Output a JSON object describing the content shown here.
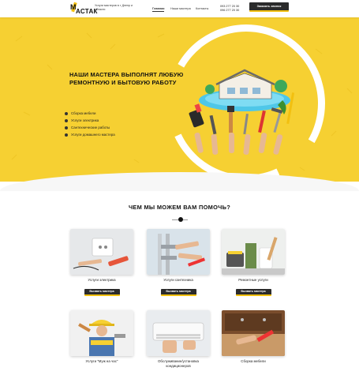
{
  "header": {
    "logo_text": "АСТАК",
    "logo_letter": "М",
    "tagline": "Услуги мастеров в г. Днепр и области",
    "nav": [
      "Главная",
      "Наши мастера",
      "Контакты"
    ],
    "phones": [
      "093 277 20 30",
      "096 277 20 30"
    ],
    "cta_label": "Заказать звонок"
  },
  "hero": {
    "title": "Наши мастера выполнят любую ремонтную и бытовую работу",
    "services": [
      "Сборка мебели",
      "Услуги электрика",
      "Сантехнические работы",
      "Услуги домашнего мастера"
    ]
  },
  "help": {
    "title": "Чем мы можем вам помочь?",
    "cards": [
      {
        "label": "Услуги электрика",
        "button": "Вызвать мастера"
      },
      {
        "label": "Услуги сантехника",
        "button": "Вызвать мастера"
      },
      {
        "label": "Ремонтные услуги",
        "button": "Вызвать мастера"
      },
      {
        "label": "Услуги \"Муж на час\"",
        "button": ""
      },
      {
        "label": "Обслуживание/установка кондиционеров",
        "button": ""
      },
      {
        "label": "Сборка мебели",
        "button": ""
      }
    ]
  },
  "colors": {
    "accent": "#f6d032",
    "button": "#2b2b2b",
    "button_border": "#f2c010"
  }
}
